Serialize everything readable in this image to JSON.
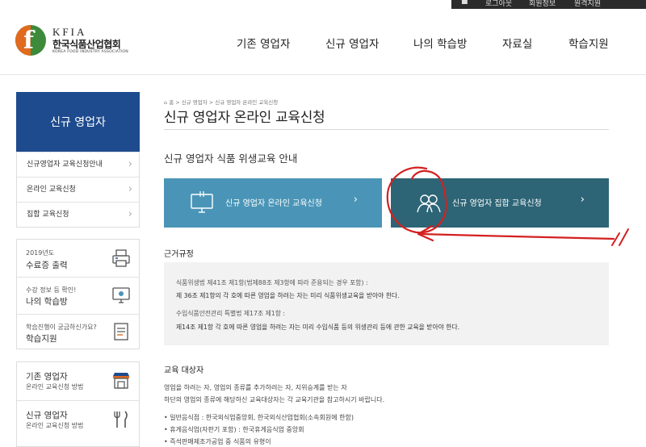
{
  "topbar": {
    "items": [
      "로그아웃",
      "회원정보",
      "원격지원"
    ]
  },
  "header": {
    "logo": {
      "en": "KFIA",
      "ko": "한국식품산업협회",
      "sub": "KOREA FOOD INDUSTRY ASSOCIATION"
    },
    "nav": [
      "기존 영업자",
      "신규 영업자",
      "나의 학습방",
      "자료실",
      "학습지원"
    ]
  },
  "sidebar": {
    "title": "신규 영업자",
    "menu": [
      "신규영업자 교육신청안내",
      "온라인 교육신청",
      "집합 교육신청"
    ],
    "quick": [
      {
        "small": "2019년도",
        "big": "수료증 출력",
        "icon": "printer-icon"
      },
      {
        "small": "수강 정보 등 확인!",
        "big": "나의 학습방",
        "icon": "monitor-icon"
      },
      {
        "small": "학습진행이 궁금하신가요?",
        "big": "학습지원",
        "icon": "document-icon"
      }
    ],
    "guide": [
      {
        "big": "기존 영업자",
        "small": "온라인 교육신청 방법",
        "icon": "store-icon"
      },
      {
        "big": "신규 영업자",
        "small": "온라인 교육신청 방법",
        "icon": "fork-knife-icon"
      }
    ]
  },
  "main": {
    "breadcrumb": "홈 > 신규 영업자 > 신규 영업자 온라인 교육신청",
    "title": "신규 영업자 온라인 교육신청",
    "section_title": "신규 영업자 식품 위생교육 안내",
    "buttons": [
      {
        "label": "신규 영업자 온라인 교육신청",
        "icon": "computer-icon"
      },
      {
        "label": "신규 영업자 집합 교육신청",
        "icon": "people-icon"
      }
    ],
    "rules": {
      "title": "근거규정",
      "lines": [
        "식품위생법 제41조 제1항(법제88조 제3항에 따라 준용되는 경우 포함) :",
        "제 36조 제1항의 각 호에 따른 영업을 하려는 자는 미리 식품위생교육을 받아야 한다.",
        "수입식품안전관리 특별법 제17조 제1항 :",
        "제14조 제1항 각 호에 따른 영업을 하려는 자는 미리 수입식품 등의 위생관리 등에 관한 교육을 받아야 한다."
      ]
    },
    "target": {
      "title": "교육 대상자",
      "lines": [
        "영업을 하려는 자, 영업의 종류를 추가하려는 자, 지위승계를 받는 자",
        "하단의 영업의 종류에 해당하신 교육대상자는 각 교육기관을 참고하시기 바랍니다."
      ],
      "bullets": [
        "일반음식점 : 한국외식업중앙회, 한국외식산업협회(소속회원에 한함)",
        "휴게음식업(자판기 포함) : 한국휴게음식업 중앙회",
        "즉석판매제조가공업 중 식품의 유형이"
      ]
    }
  },
  "colors": {
    "sidebar_title_bg": "#1e4b8e",
    "button_online_bg": "#4a95b7",
    "button_group_bg": "#2d6576",
    "annotation_red": "#d42020"
  }
}
